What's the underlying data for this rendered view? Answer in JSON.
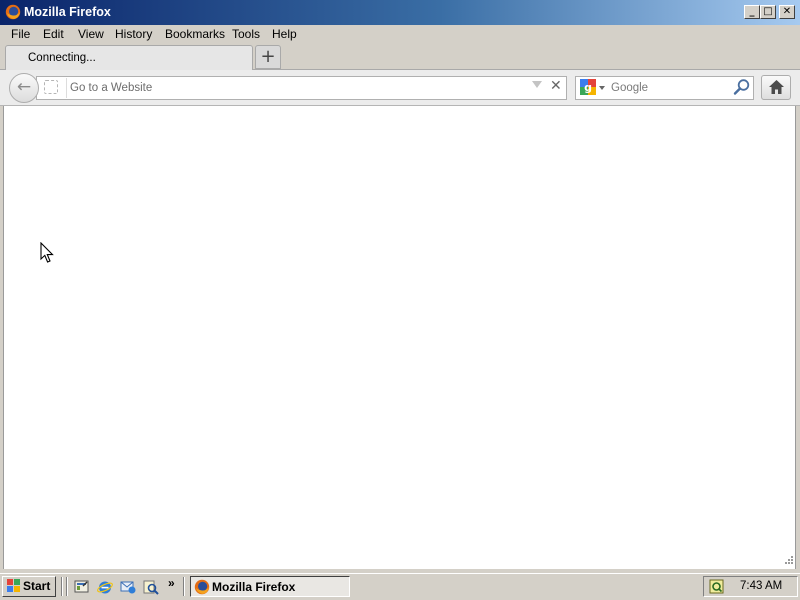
{
  "window": {
    "title": "Mozilla Firefox"
  },
  "caption_buttons": [
    "minimize-icon",
    "maximize-icon",
    "close-icon"
  ],
  "menu": {
    "items": [
      "File",
      "Edit",
      "View",
      "History",
      "Bookmarks",
      "Tools",
      "Help"
    ]
  },
  "tabs": {
    "active_label": "Connecting...",
    "new_tab_icon": "plus-icon"
  },
  "navigation": {
    "back_icon": "back-arrow-icon",
    "url_placeholder": "Go to a Website",
    "url_value": "",
    "search_engine_icon": "google-icon",
    "search_placeholder": "Google",
    "search_value": "",
    "home_icon": "home-icon"
  },
  "taskbar": {
    "start_label": "Start",
    "quick_launch_icons": [
      "show-desktop-icon",
      "internet-explorer-icon",
      "outlook-express-icon",
      "search-icon"
    ],
    "more": "»",
    "task_label": "Mozilla Firefox",
    "clock": "7:43 AM"
  },
  "colors": {
    "titlebar_start": "#0a246a",
    "titlebar_end": "#a6caf0",
    "chrome": "#d4d0c8"
  }
}
